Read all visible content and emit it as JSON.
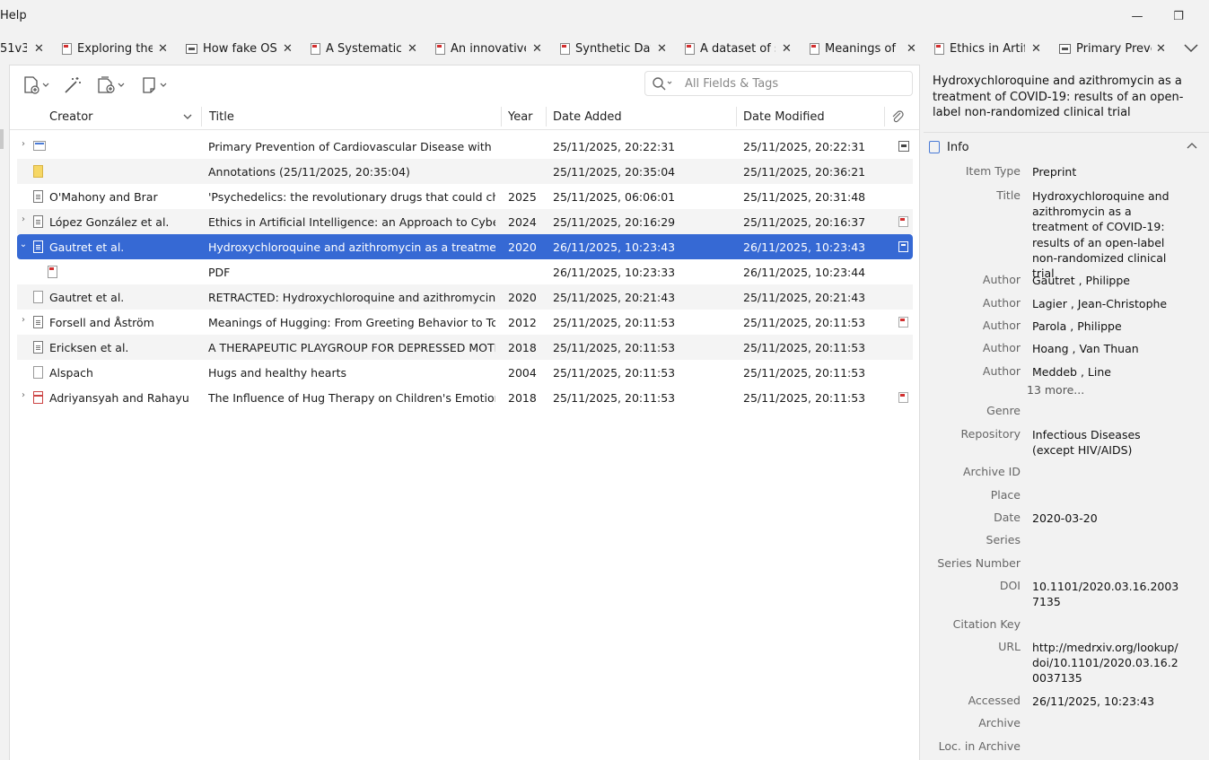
{
  "menubar": {
    "help": "Help"
  },
  "window_controls": {
    "minimize": "—",
    "restore": "❐"
  },
  "tabs": [
    {
      "label": "51v3",
      "icon": "none"
    },
    {
      "label": "Exploring the I",
      "icon": "pdf"
    },
    {
      "label": "How fake OSIN",
      "icon": "snapshot"
    },
    {
      "label": "A Systematic R",
      "icon": "pdf"
    },
    {
      "label": "An innovative (",
      "icon": "pdf"
    },
    {
      "label": "Synthetic Data",
      "icon": "pdf"
    },
    {
      "label": "A dataset of sy",
      "icon": "pdf"
    },
    {
      "label": "Meanings of H",
      "icon": "pdf"
    },
    {
      "label": "Ethics in Artific",
      "icon": "pdf"
    },
    {
      "label": "Primary Preven",
      "icon": "snapshot"
    }
  ],
  "tab_close": "✕",
  "search": {
    "placeholder": "All Fields & Tags"
  },
  "columns": {
    "creator": "Creator",
    "title": "Title",
    "year": "Year",
    "date_added": "Date Added",
    "date_modified": "Date Modified"
  },
  "rows": [
    {
      "twisty": ">",
      "icon": "web",
      "creator": "",
      "title": "Primary Prevention of Cardiovascular Disease with a ...",
      "year": "",
      "added": "25/11/2025, 20:22:31",
      "modified": "25/11/2025, 20:22:31",
      "att": "snap"
    },
    {
      "twisty": "",
      "icon": "note",
      "creator": "",
      "title": "Annotations (25/11/2025, 20:35:04)",
      "year": "",
      "added": "25/11/2025, 20:35:04",
      "modified": "25/11/2025, 20:36:21",
      "att": ""
    },
    {
      "twisty": "",
      "icon": "doc",
      "creator": "O'Mahony and Brar",
      "title": "'Psychedelics: the revolutionary drugs that could cha...",
      "year": "2025",
      "added": "25/11/2025, 06:06:01",
      "modified": "25/11/2025, 20:31:48",
      "att": ""
    },
    {
      "twisty": ">",
      "icon": "doc",
      "creator": "López González et al.",
      "title": "Ethics in Artificial Intelligence: an Approach to Cybers...",
      "year": "2024",
      "added": "25/11/2025, 20:16:29",
      "modified": "25/11/2025, 20:16:37",
      "att": "pdf"
    },
    {
      "twisty": "v",
      "icon": "doc",
      "creator": "Gautret et al.",
      "title": "Hydroxychloroquine and azithromycin as a treatment...",
      "year": "2020",
      "added": "26/11/2025, 10:23:43",
      "modified": "26/11/2025, 10:23:43",
      "att": "sel",
      "selected": true
    },
    {
      "twisty": "",
      "icon": "pdfchild",
      "creator": "",
      "title": "PDF",
      "year": "",
      "added": "26/11/2025, 10:23:33",
      "modified": "26/11/2025, 10:23:44",
      "att": ""
    },
    {
      "twisty": "",
      "icon": "blank",
      "creator": "Gautret et al.",
      "title": "RETRACTED: Hydroxychloroquine and azithromycin a...",
      "year": "2020",
      "added": "25/11/2025, 20:21:43",
      "modified": "25/11/2025, 20:21:43",
      "att": ""
    },
    {
      "twisty": ">",
      "icon": "doc",
      "creator": "Forsell and Åström",
      "title": "Meanings of Hugging: From Greeting Behavior to To...",
      "year": "2012",
      "added": "25/11/2025, 20:11:53",
      "modified": "25/11/2025, 20:11:53",
      "att": "pdf"
    },
    {
      "twisty": "",
      "icon": "doc",
      "creator": "Ericksen et al.",
      "title": "A THERAPEUTIC PLAYGROUP FOR DEPRESSED MOTH...",
      "year": "2018",
      "added": "25/11/2025, 20:11:53",
      "modified": "25/11/2025, 20:11:53",
      "att": ""
    },
    {
      "twisty": "",
      "icon": "blank",
      "creator": "Alspach",
      "title": "Hugs and healthy hearts",
      "year": "2004",
      "added": "25/11/2025, 20:11:53",
      "modified": "25/11/2025, 20:11:53",
      "att": ""
    },
    {
      "twisty": ">",
      "icon": "gift",
      "creator": "Adriyansyah and Rahayu",
      "title": "The Influence of Hug Therapy on Children's Emotion...",
      "year": "2018",
      "added": "25/11/2025, 20:11:53",
      "modified": "25/11/2025, 20:11:53",
      "att": "pdf"
    }
  ],
  "right_pane": {
    "title": "Hydroxychloroquine and azithromycin as a treatment of COVID-19: results of an open-label non-randomized clinical trial",
    "info_label": "Info",
    "more_authors": "13 more...",
    "fields": [
      {
        "label": "Item Type",
        "value": "Preprint"
      },
      {
        "label": "Title",
        "value": "Hydroxychloroquine and azithromycin as a treatment of COVID-19: results of an open-label non-randomized clinical trial"
      },
      {
        "label": "Author",
        "value": "Gautret , Philippe"
      },
      {
        "label": "Author",
        "value": "Lagier , Jean-Christophe"
      },
      {
        "label": "Author",
        "value": "Parola , Philippe"
      },
      {
        "label": "Author",
        "value": "Hoang , Van Thuan"
      },
      {
        "label": "Author",
        "value": "Meddeb , Line"
      },
      {
        "label": "Genre",
        "value": ""
      },
      {
        "label": "Repository",
        "value": "Infectious Diseases (except HIV/AIDS)"
      },
      {
        "label": "Archive ID",
        "value": ""
      },
      {
        "label": "Place",
        "value": ""
      },
      {
        "label": "Date",
        "value": "2020-03-20"
      },
      {
        "label": "Series",
        "value": ""
      },
      {
        "label": "Series Number",
        "value": ""
      },
      {
        "label": "DOI",
        "value": "10.1101/2020.03.16.20037135"
      },
      {
        "label": "Citation Key",
        "value": ""
      },
      {
        "label": "URL",
        "value": "http://medrxiv.org/lookup/doi/10.1101/2020.03.16.20037135"
      },
      {
        "label": "Accessed",
        "value": "26/11/2025, 10:23:43"
      },
      {
        "label": "Archive",
        "value": ""
      },
      {
        "label": "Loc. in Archive",
        "value": ""
      }
    ]
  },
  "colors": {
    "selection": "#3669d4",
    "pdf_red": "#d23030",
    "accent_blue": "#4a7bd6"
  }
}
